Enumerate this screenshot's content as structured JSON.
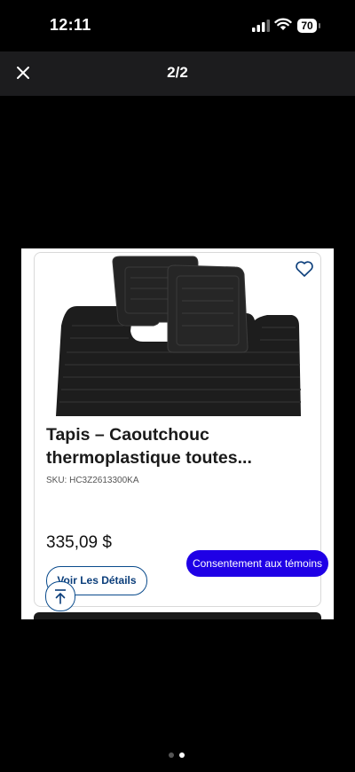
{
  "status_bar": {
    "time": "12:11",
    "battery_level": "70",
    "icons": [
      "signal-icon",
      "wifi-icon",
      "battery-icon"
    ]
  },
  "viewer": {
    "title": "2/2",
    "close_icon": "close-icon"
  },
  "product": {
    "title": "Tapis – Caoutchouc thermoplastique toutes...",
    "sku": "SKU: HC3Z2613300KA",
    "price": "335,09 $",
    "details_button": "Voir Les Détails",
    "favorite_icon": "heart-icon"
  },
  "cookie_button": "Consentement aux témoins",
  "pager": {
    "pages": 2,
    "current": 2
  },
  "colors": {
    "accent_blue": "#1f00e6",
    "button_outline": "#0a4b8c"
  }
}
